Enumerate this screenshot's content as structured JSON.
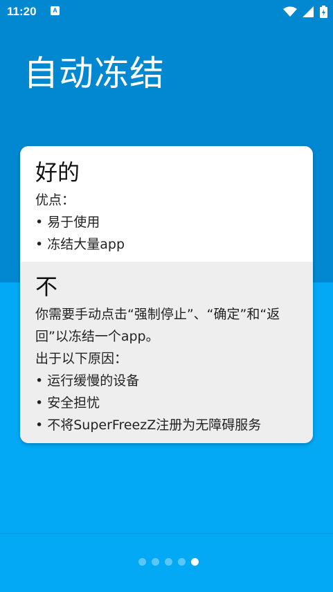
{
  "status_bar": {
    "time": "11:20",
    "notification_letter": "A",
    "icons": [
      "wifi-icon",
      "signal-icon",
      "battery-charging-icon"
    ]
  },
  "header": {
    "title": "自动冻结"
  },
  "card": {
    "good": {
      "heading": "好的",
      "label": "优点：",
      "items": [
        "• 易于使用",
        "• 冻结大量app"
      ]
    },
    "bad": {
      "heading": "不",
      "description_line1": "你需要手动点击“强制停止”、“确定”和“返",
      "description_line2": "回”以冻结一个app。",
      "label": "出于以下原因：",
      "items": [
        "• 运行缓慢的设备",
        "• 安全担忧",
        "• 不将SuperFreezZ注册为无障碍服务"
      ]
    }
  },
  "pager": {
    "total_pages": 5,
    "current_page": 5
  },
  "colors": {
    "top_background": "#0288d1",
    "bottom_background": "#03a9f4",
    "card_good": "#ffffff",
    "card_bad": "#eeeeee"
  }
}
